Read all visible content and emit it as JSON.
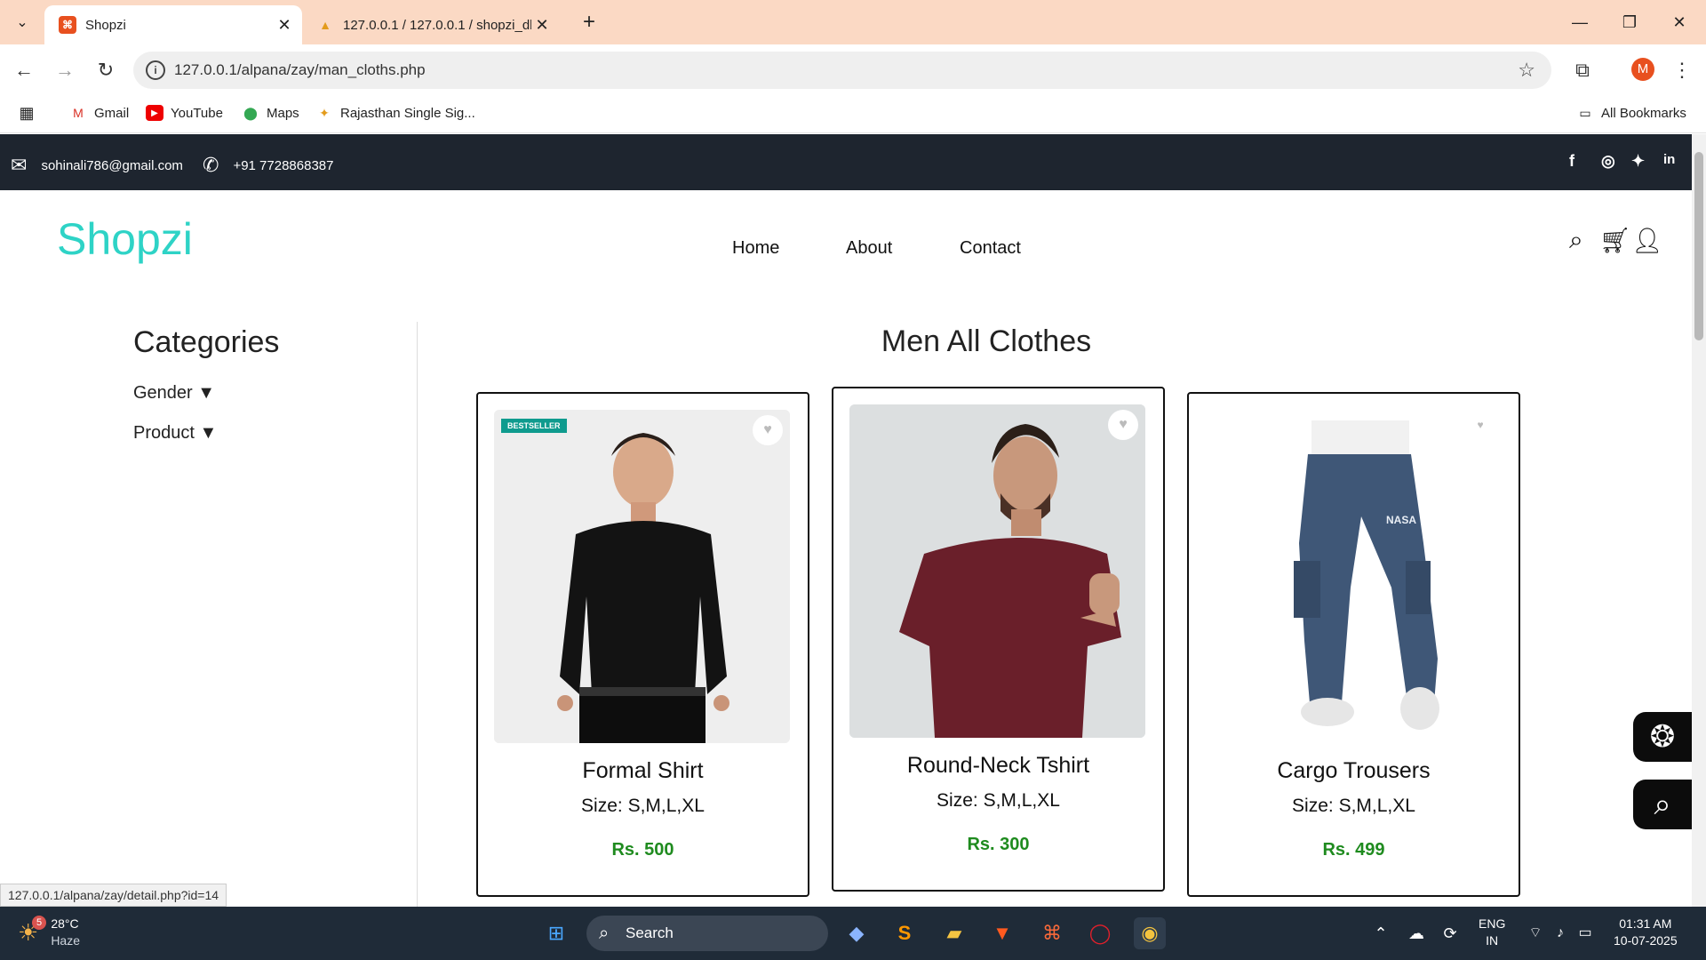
{
  "browser": {
    "tabs": [
      {
        "title": "Shopzi",
        "active": true
      },
      {
        "title": "127.0.0.1 / 127.0.0.1 / shopzi_db",
        "active": false
      }
    ],
    "url": "127.0.0.1/alpana/zay/man_cloths.php",
    "profile_initial": "M",
    "bookmarks": [
      "Gmail",
      "YouTube",
      "Maps",
      "Rajasthan Single Sig..."
    ],
    "all_bookmarks": "All Bookmarks",
    "status_url": "127.0.0.1/alpana/zay/detail.php?id=14"
  },
  "topbar": {
    "email": "sohinali786@gmail.com",
    "phone": "+91 7728868387",
    "social_icons": [
      "facebook-icon",
      "instagram-icon",
      "twitter-icon",
      "linkedin-icon"
    ]
  },
  "header": {
    "logo": "Shopzi",
    "nav": [
      "Home",
      "About",
      "Contact"
    ]
  },
  "sidebar": {
    "title": "Categories",
    "items": [
      "Gender ▼",
      "Product ▼"
    ]
  },
  "main": {
    "title": "Men All Clothes",
    "products": [
      {
        "name": "Formal Shirt",
        "size": "Size: S,M,L,XL",
        "price": "Rs. 500",
        "badge": "BESTSELLER"
      },
      {
        "name": "Round-Neck Tshirt",
        "size": "Size: S,M,L,XL",
        "price": "Rs. 300"
      },
      {
        "name": "Cargo Trousers",
        "size": "Size: S,M,L,XL",
        "price": "Rs. 499"
      }
    ]
  },
  "taskbar": {
    "weather_temp": "28°C",
    "weather_desc": "Haze",
    "weather_badge": "5",
    "search": "Search",
    "lang": "ENG",
    "region": "IN",
    "time": "01:31 AM",
    "date": "10-07-2025"
  }
}
